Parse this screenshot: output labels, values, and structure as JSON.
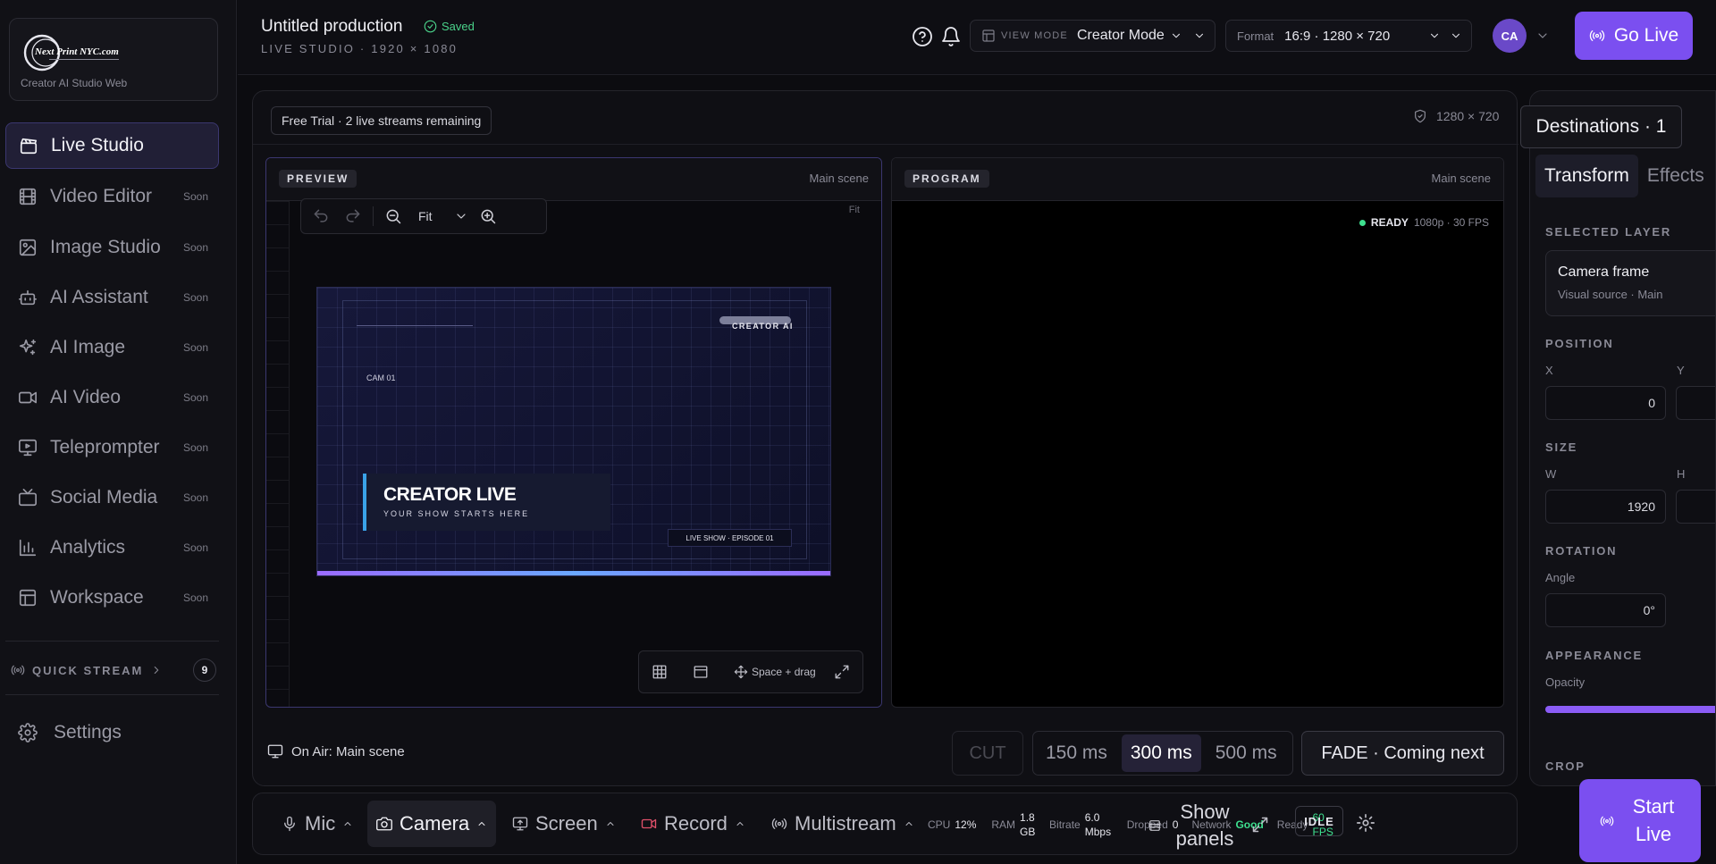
{
  "brand": {
    "logo_text": "Next Print NYC.com",
    "subtitle": "Creator AI Studio Web"
  },
  "sidebar": {
    "items": [
      {
        "label": "Live Studio",
        "badge": "",
        "icon": "clapper-icon"
      },
      {
        "label": "Video Editor",
        "badge": "Soon",
        "icon": "film-icon"
      },
      {
        "label": "Image Studio",
        "badge": "Soon",
        "icon": "image-icon"
      },
      {
        "label": "AI Assistant",
        "badge": "Soon",
        "icon": "bot-icon"
      },
      {
        "label": "AI Image",
        "badge": "Soon",
        "icon": "sparkles-icon"
      },
      {
        "label": "AI Video",
        "badge": "Soon",
        "icon": "video-icon"
      },
      {
        "label": "Teleprompter",
        "badge": "Soon",
        "icon": "presentation-icon"
      },
      {
        "label": "Social Media",
        "badge": "Soon",
        "icon": "tv-icon"
      },
      {
        "label": "Analytics",
        "badge": "Soon",
        "icon": "bar-chart-icon"
      },
      {
        "label": "Workspace",
        "badge": "Soon",
        "icon": "layout-icon"
      }
    ],
    "quick_stream": {
      "label": "QUICK STREAM",
      "count": "9"
    },
    "settings_label": "Settings"
  },
  "header": {
    "title": "Untitled production",
    "saved": "Saved",
    "subtitle": "LIVE STUDIO · 1920 × 1080",
    "view_mode_label": "VIEW MODE",
    "view_mode_value": "Creator Mode",
    "format_label": "Format",
    "format_value": "16:9 · 1280 × 720",
    "avatar": "CA",
    "go_live": "Go Live"
  },
  "main": {
    "trial": "Free Trial · 2 live streams remaining",
    "resolution": "1280 × 720",
    "preview": {
      "tag": "PREVIEW",
      "scene": "Main scene",
      "zoom": "Fit",
      "fit_hint": "Fit",
      "pan_hint": "Space + drag"
    },
    "stage": {
      "cam": "CAM 01",
      "brand": "CREATOR AI",
      "title": "CREATOR LIVE",
      "tagline": "YOUR SHOW STARTS HERE",
      "episode": "LIVE SHOW · EPISODE 01"
    },
    "program": {
      "tag": "PROGRAM",
      "scene": "Main scene",
      "status": "READY",
      "spec": "1080p · 30 FPS"
    },
    "on_air": "On Air: Main scene",
    "cut": "CUT",
    "durations": [
      "150 ms",
      "300 ms",
      "500 ms"
    ],
    "selected_duration": "300 ms",
    "fade": "FADE · Coming next"
  },
  "right_panel": {
    "destinations": "Destinations · 1",
    "tabs": [
      "Transform",
      "Effects"
    ],
    "selected_layer_label": "SELECTED LAYER",
    "layer_name": "Camera frame",
    "layer_sub": "Visual source · Main",
    "position_label": "POSITION",
    "x_label": "X",
    "x_value": "0",
    "y_label": "Y",
    "size_label": "SIZE",
    "w_label": "W",
    "w_value": "1920",
    "h_label": "H",
    "rotation_label": "ROTATION",
    "angle_label": "Angle",
    "angle_value": "0°",
    "appearance_label": "APPEARANCE",
    "opacity_label": "Opacity",
    "opacity": 1.0,
    "crop_label": "CROP"
  },
  "bottom_bar": {
    "mic": "Mic",
    "camera": "Camera",
    "screen": "Screen",
    "record": "Record",
    "multistream": "Multistream",
    "cpu_label": "CPU",
    "cpu": "12%",
    "ram_label": "RAM",
    "ram": "1.8 GB",
    "bitrate_label": "Bitrate",
    "bitrate": "6.0 Mbps",
    "dropped_label": "Dropped",
    "dropped": "0",
    "network_label": "Network",
    "network": "Good",
    "ready_label": "Ready",
    "fps": "60 FPS",
    "show_panels": "Show panels",
    "idle": "IDLE",
    "start_live": "Start Live"
  },
  "colors": {
    "accent": "#7b4ff0",
    "success": "#3ee08f",
    "record": "#e0506a"
  }
}
